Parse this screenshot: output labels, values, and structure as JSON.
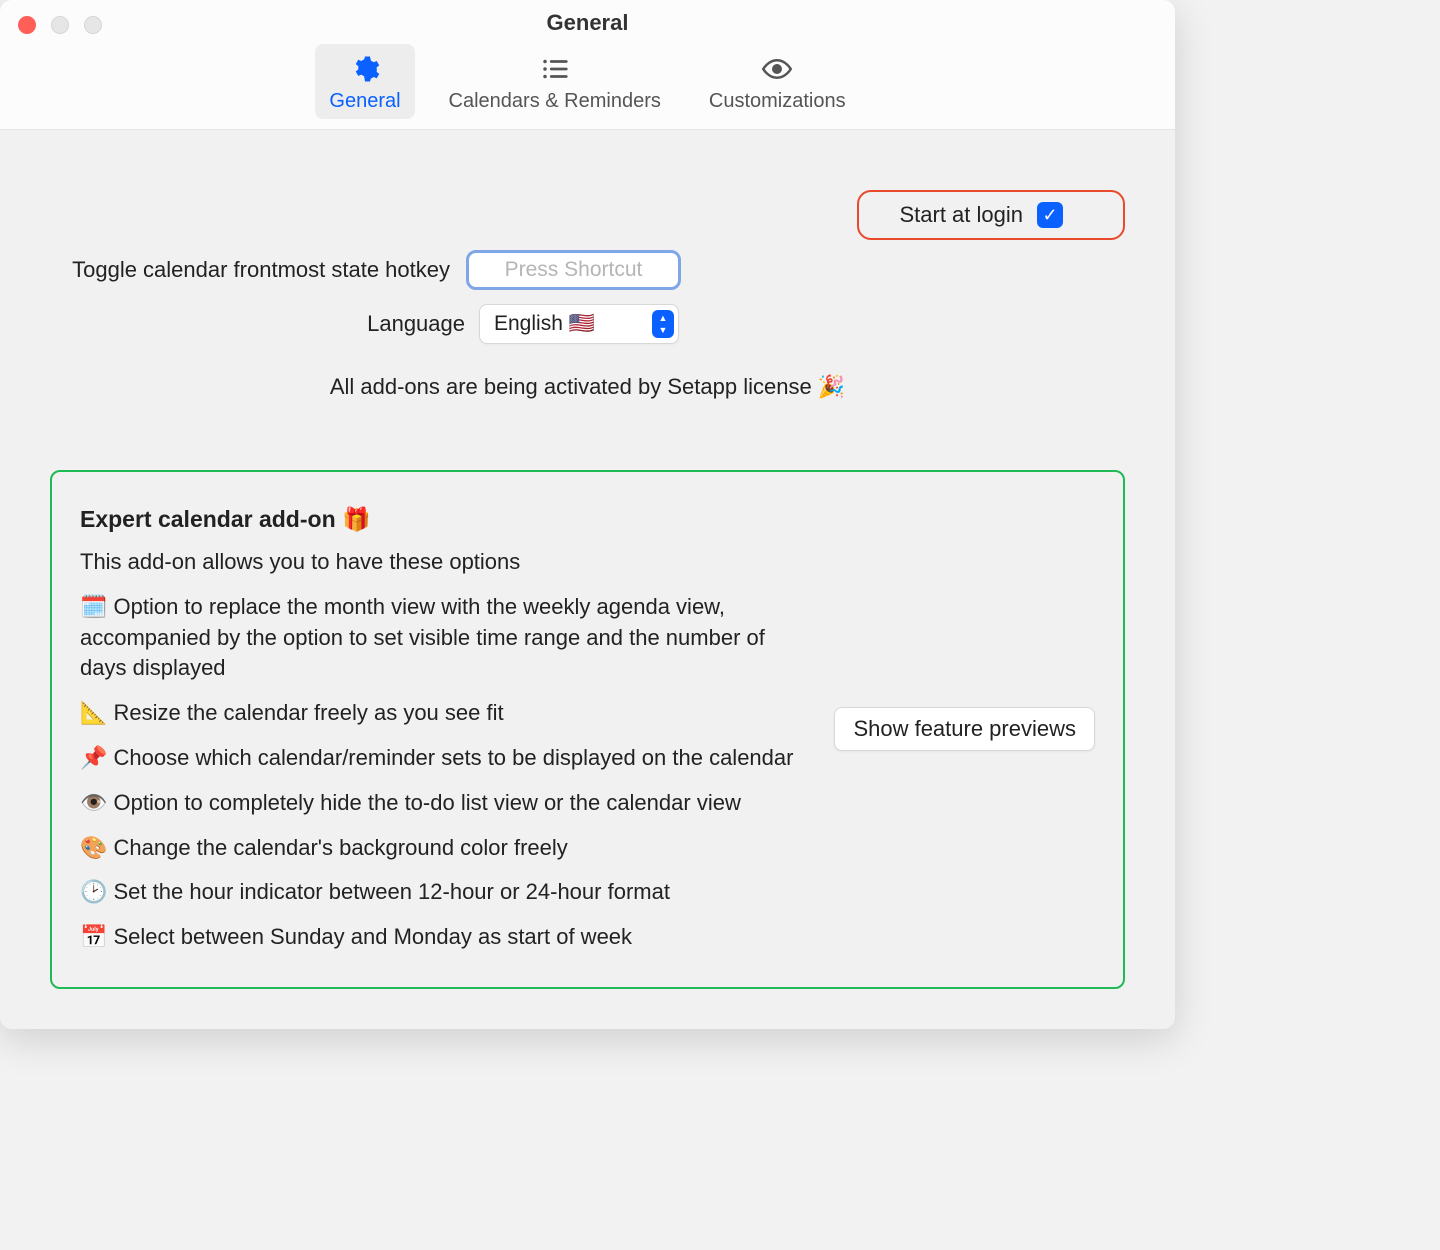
{
  "window": {
    "title": "General"
  },
  "tabs": {
    "general": "General",
    "calendars": "Calendars & Reminders",
    "customizations": "Customizations"
  },
  "form": {
    "start_at_login_label": "Start at login",
    "start_at_login_checked": true,
    "toggle_hotkey_label": "Toggle calendar frontmost state hotkey",
    "shortcut_placeholder": "Press Shortcut",
    "language_label": "Language",
    "language_value": "English 🇺🇸"
  },
  "license_line": "All add-ons are being activated by Setapp license 🎉",
  "addon": {
    "title": "Expert calendar add-on 🎁",
    "lead": "This add-on allows you to have these options",
    "features": [
      "🗓️ Option to replace the month view with the weekly agenda view, accompanied by the option to set visible time range and the number of days displayed",
      "📐 Resize the calendar freely as you see fit",
      "📌 Choose which calendar/reminder sets to be displayed on the calendar",
      "👁️ Option to completely hide the to-do list view or the calendar view",
      "🎨 Change the calendar's background color freely",
      "🕑 Set the hour indicator between 12-hour or 24-hour format",
      "📅 Select between Sunday and Monday as start of week"
    ],
    "preview_button": "Show feature previews"
  }
}
